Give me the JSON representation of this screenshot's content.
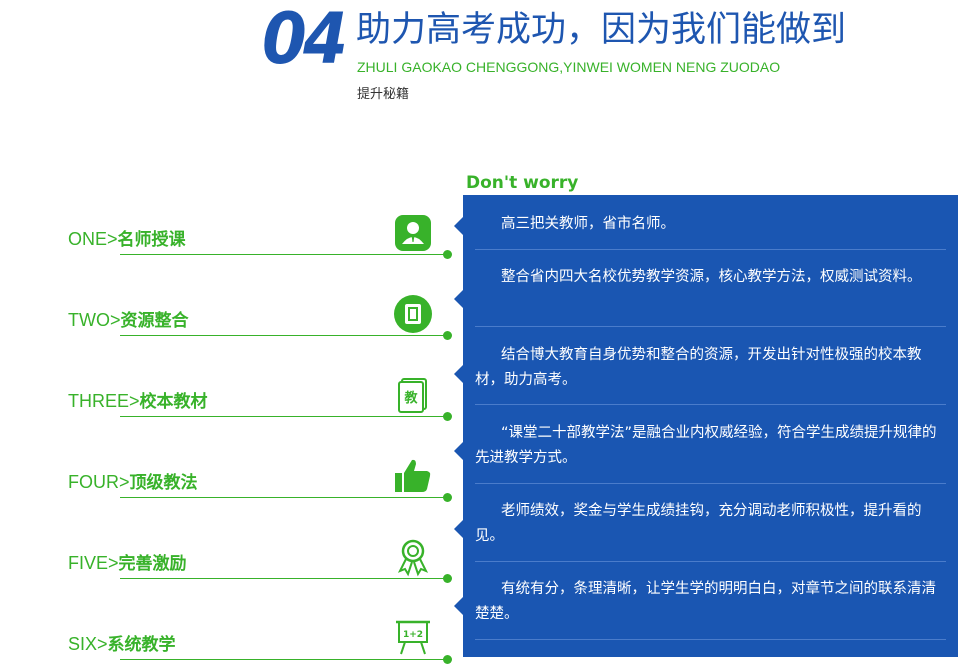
{
  "header": {
    "number": "04",
    "title": "助力高考成功，因为我们能做到",
    "pinyin": "ZHULI GAOKAO CHENGGONG,YINWEI WOMEN NENG ZUODAO",
    "subtitle": "提升秘籍"
  },
  "tagline": "Don't worry",
  "items": [
    {
      "num": "ONE>",
      "name": "名师授课",
      "icon": "teacher-icon",
      "icon_text": ""
    },
    {
      "num": "TWO>",
      "name": "资源整合",
      "icon": "book-icon",
      "icon_text": ""
    },
    {
      "num": "THREE>",
      "name": "校本教材",
      "icon": "textbook-icon",
      "icon_text": "教"
    },
    {
      "num": "FOUR>",
      "name": "顶级教法",
      "icon": "thumbs-up-icon",
      "icon_text": ""
    },
    {
      "num": "FIVE>",
      "name": "完善激励",
      "icon": "award-ribbon-icon",
      "icon_text": ""
    },
    {
      "num": "SIX>",
      "name": "系统教学",
      "icon": "blackboard-icon",
      "icon_text": "1+2"
    }
  ],
  "panel": {
    "rows": [
      "高三把关教师，省市名师。",
      "整合省内四大名校优势教学资源，核心教学方法，权威测试资料。",
      "结合博大教育自身优势和整合的资源，开发出针对性极强的校本教材，助力高考。",
      "“课堂二十部教学法”是融合业内权威经验，符合学生成绩提升规律的先进教学方式。",
      "老师绩效，奖金与学生成绩挂钩，充分调动老师积极性，提升看的见。",
      "有统有分，条理清晰，让学生学的明明白白，对章节之间的联系清清楚楚。"
    ]
  },
  "colors": {
    "brand_blue": "#1e56b0",
    "panel_blue": "#1a56b2",
    "accent_green": "#38b22a"
  }
}
